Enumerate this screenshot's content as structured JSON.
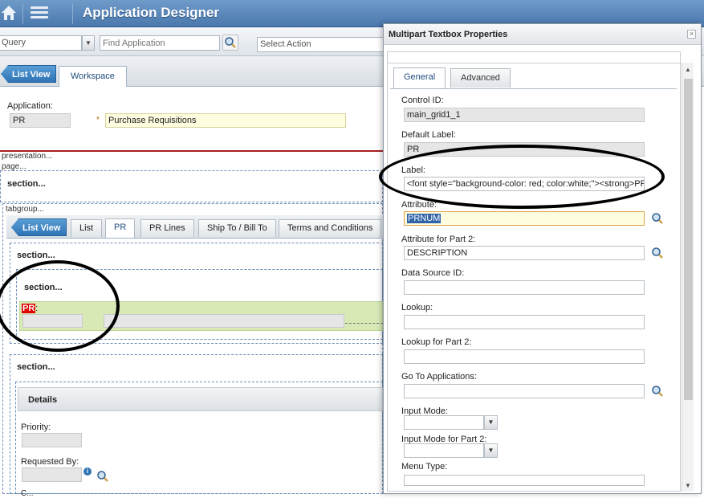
{
  "banner": {
    "title": "Application Designer",
    "home_icon": "home-icon",
    "menu_icon": "menu-icon"
  },
  "toolbar": {
    "query_value": "Query",
    "find_placeholder": "Find Application",
    "action_value": "Select Action"
  },
  "tabs": {
    "list_view": "List View",
    "workspace": "Workspace"
  },
  "workspace": {
    "application_label": "Application:",
    "application_value": "PR",
    "required_marker": "*",
    "description_value": "Purchase Requisitions",
    "presentation_label": "presentation...",
    "page_label": "page...",
    "section_label": "section...",
    "tabgroup_label": "tabgroup...",
    "inner_tabs": [
      "List",
      "PR",
      "PR Lines",
      "Ship To / Bill To",
      "Terms and Conditions"
    ],
    "inner_list_view": "List View",
    "section2_label": "section...",
    "section3_label": "section...",
    "pr_label_text": "PR",
    "pr_label_colon": ":",
    "section4_label": "section...",
    "details_label": "Details",
    "priority_label": "Priority:",
    "requested_by_label": "Requested By:",
    "cut_label": "C..."
  },
  "dialog": {
    "title": "Multipart Textbox Properties",
    "close_glyph": "×",
    "tab_general": "General",
    "tab_advanced": "Advanced",
    "fields": {
      "control_id_label": "Control ID:",
      "control_id_value": "main_grid1_1",
      "default_label_label": "Default Label:",
      "default_label_value": "PR",
      "label_label": "Label:",
      "label_value": "<font style=\"background-color: red; color:white;\"><strong>PR",
      "attribute_label": "Attribute:",
      "attribute_value": "PRNUM",
      "attribute2_label": "Attribute for Part 2:",
      "attribute2_value": "DESCRIPTION",
      "datasource_label": "Data Source ID:",
      "lookup_label": "Lookup:",
      "lookup2_label": "Lookup for Part 2:",
      "goto_label": "Go To Applications:",
      "input_mode_label": "Input Mode:",
      "input_mode2_label": "Input Mode for Part 2:",
      "menu_type_label": "Menu Type:"
    }
  },
  "colors": {
    "banner": "#4a78ad",
    "accent_blue": "#2f74b5",
    "required_bg": "#fffde0",
    "highlight_row": "#d8e9b5",
    "red_label": "#e00000",
    "selection": "#3163a8"
  }
}
